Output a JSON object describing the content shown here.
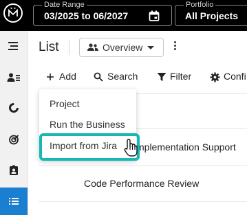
{
  "header": {
    "date_range": {
      "legend": "Date Range",
      "value": "03/2025 to 06/2027"
    },
    "portfolio": {
      "legend": "Portfolio",
      "value": "All Projects"
    }
  },
  "sidebar": {
    "items": [
      {
        "icon": "menu-icon"
      },
      {
        "icon": "people-list-icon"
      },
      {
        "icon": "donut-chart-icon"
      },
      {
        "icon": "target-icon"
      },
      {
        "icon": "id-badge-icon"
      },
      {
        "icon": "list-icon",
        "active": true
      }
    ],
    "active_color": "#1a7fd1"
  },
  "main": {
    "title": "List",
    "view_select": {
      "value": "Overview"
    },
    "toolbar": {
      "add_label": "Add",
      "search_label": "Search",
      "filter_label": "Filter",
      "config_label": "Confi"
    },
    "rows": [
      {
        "name": "mplementation Support"
      },
      {
        "name": "Code Performance Review"
      }
    ]
  },
  "add_menu": {
    "items": [
      {
        "label": "Project"
      },
      {
        "label": "Run the Business"
      },
      {
        "label": "Import from Jira",
        "highlighted": true
      }
    ],
    "highlight_color": "#17b8b3"
  }
}
